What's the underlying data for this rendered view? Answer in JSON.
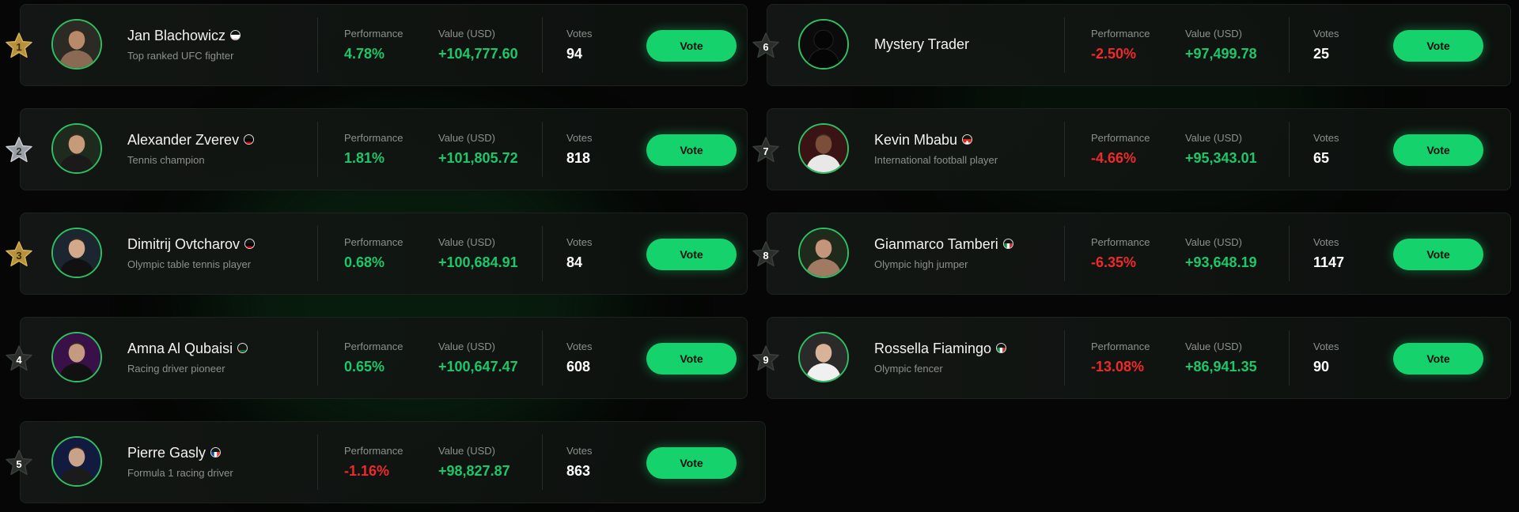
{
  "labels": {
    "performance": "Performance",
    "value": "Value (USD)",
    "votes": "Votes",
    "vote_button": "Vote"
  },
  "colors": {
    "accent": "#16d26d",
    "positive": "#1ec66a",
    "negative": "#ee2a2a",
    "gold": "#b8923a",
    "silver": "#9aa0a6",
    "dark_star": "#2a2e2b"
  },
  "entries": [
    {
      "rank": "1",
      "rank_style": "gold",
      "name": "Jan Blachowicz",
      "flag": "poland",
      "subtitle": "Top ranked UFC fighter",
      "performance": "4.78%",
      "trend": "positive",
      "value": "+104,777.60",
      "votes": "94"
    },
    {
      "rank": "2",
      "rank_style": "silver",
      "name": "Alexander Zverev",
      "flag": "germany",
      "subtitle": "Tennis champion",
      "performance": "1.81%",
      "trend": "positive",
      "value": "+101,805.72",
      "votes": "818"
    },
    {
      "rank": "3",
      "rank_style": "gold",
      "name": "Dimitrij Ovtcharov",
      "flag": "germany",
      "subtitle": "Olympic table tennis player",
      "performance": "0.68%",
      "trend": "positive",
      "value": "+100,684.91",
      "votes": "84"
    },
    {
      "rank": "4",
      "rank_style": "dark",
      "name": "Amna Al Qubaisi",
      "flag": "uae",
      "subtitle": "Racing driver pioneer",
      "performance": "0.65%",
      "trend": "positive",
      "value": "+100,647.47",
      "votes": "608"
    },
    {
      "rank": "5",
      "rank_style": "dark",
      "name": "Pierre Gasly",
      "flag": "france",
      "subtitle": "Formula 1 racing driver",
      "performance": "-1.16%",
      "trend": "negative",
      "value": "+98,827.87",
      "votes": "863"
    },
    {
      "rank": "6",
      "rank_style": "dark",
      "name": "Mystery Trader",
      "flag": "",
      "subtitle": "",
      "performance": "-2.50%",
      "trend": "negative",
      "value": "+97,499.78",
      "votes": "25"
    },
    {
      "rank": "7",
      "rank_style": "dark",
      "name": "Kevin Mbabu",
      "flag": "switzerland",
      "subtitle": "International football player",
      "performance": "-4.66%",
      "trend": "negative",
      "value": "+95,343.01",
      "votes": "65"
    },
    {
      "rank": "8",
      "rank_style": "dark",
      "name": "Gianmarco Tamberi",
      "flag": "italy",
      "subtitle": "Olympic high jumper",
      "performance": "-6.35%",
      "trend": "negative",
      "value": "+93,648.19",
      "votes": "1147"
    },
    {
      "rank": "9",
      "rank_style": "dark",
      "name": "Rossella Fiamingo",
      "flag": "italy",
      "subtitle": "Olympic fencer",
      "performance": "-13.08%",
      "trend": "negative",
      "value": "+86,941.35",
      "votes": "90"
    }
  ]
}
